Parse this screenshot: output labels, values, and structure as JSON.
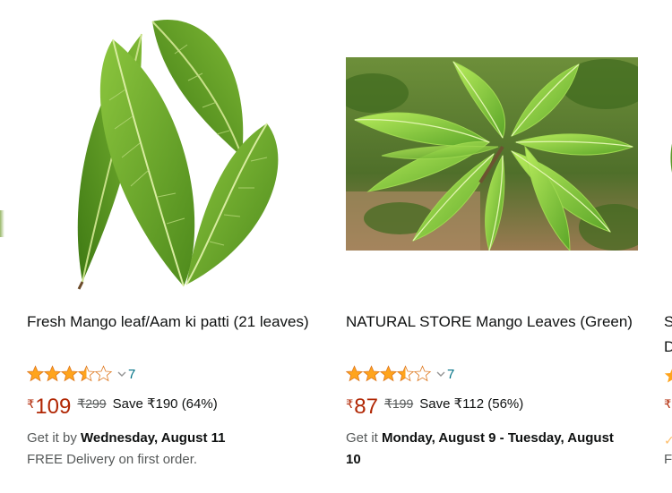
{
  "products": [
    {
      "title": "Fresh Mango leaf/Aam ki patti (21 leaves)",
      "rating": 3.5,
      "rating_count": "7",
      "currency": "₹",
      "price": "109",
      "mrp": "₹299",
      "save": "Save ₹190 (64%)",
      "delivery_prefix": "Get it by ",
      "delivery_date": "Wednesday, August 11",
      "delivery_note": "FREE Delivery on first order.",
      "image_icon": "mango-leaves-icon"
    },
    {
      "title": "NATURAL STORE Mango Leaves (Green)",
      "rating": 3.5,
      "rating_count": "7",
      "currency": "₹",
      "price": "87",
      "mrp": "₹199",
      "save": "Save ₹112 (56%)",
      "delivery_prefix": "Get it ",
      "delivery_date": "Monday, August 9 - Tuesday, August 10",
      "image_icon": "mango-tree-photo"
    }
  ],
  "partial_card": {
    "title_line1": "S",
    "title_line2": "D",
    "currency": "₹",
    "delivery_fragment": "✓",
    "delivery_fragment2": "F"
  },
  "colors": {
    "price": "#b12704",
    "link": "#007185",
    "star": "#ffa41c",
    "text": "#0f1111",
    "muted": "#565959"
  }
}
